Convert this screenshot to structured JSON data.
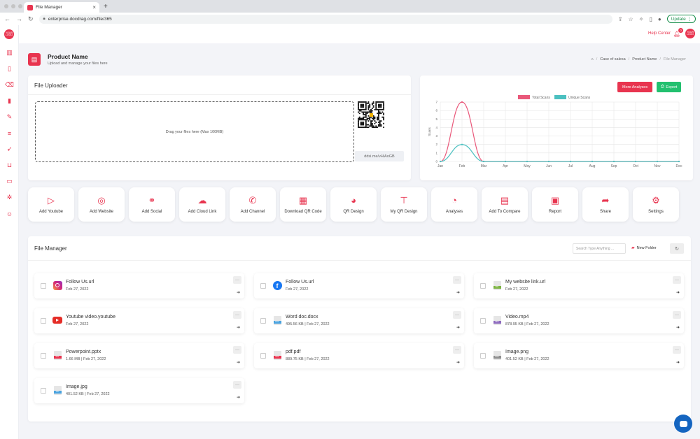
{
  "browser": {
    "tab_title": "File Manager",
    "url": "enterprise.docdrag.com/file/365",
    "update_label": "Update"
  },
  "sidebar": {
    "logo_text": "YOUR LOGO",
    "icons": [
      "bar-chart-icon",
      "document-icon",
      "trash-icon",
      "stats-icon",
      "brush-icon",
      "list-icon",
      "rocket-icon",
      "cart-icon",
      "card-icon",
      "settings-icon",
      "user-icon"
    ]
  },
  "topbar": {
    "help_label": "Help Center",
    "notification_count": "0",
    "avatar_text": "YOUR LOGO"
  },
  "header": {
    "title": "Product Name",
    "subtitle": "Upload and manage your files here",
    "breadcrumb": [
      "Case of salesa",
      "Product Name",
      "File Manager"
    ]
  },
  "uploader": {
    "title": "File Uploader",
    "drop_text": "Drag your files here (Max 100MB)",
    "short_link": "ddsi.me/vHiAoGB"
  },
  "chart_card": {
    "more_label": "More Analyses",
    "export_label": "Export"
  },
  "chart_data": {
    "type": "line",
    "categories": [
      "Jan",
      "Feb",
      "Mar",
      "Apr",
      "May",
      "Jun",
      "Jul",
      "Aug",
      "Sep",
      "Oct",
      "Nov",
      "Dec"
    ],
    "series": [
      {
        "name": "Total Scans",
        "color": "#e9587a",
        "values": [
          0,
          7,
          0,
          0,
          0,
          0,
          0,
          0,
          0,
          0,
          0,
          0
        ]
      },
      {
        "name": "Unique Scans",
        "color": "#4bc0c0",
        "values": [
          0,
          2,
          0,
          0,
          0,
          0,
          0,
          0,
          0,
          0,
          0,
          0
        ]
      }
    ],
    "ylabel": "Scans",
    "ylim": [
      0,
      7
    ],
    "yticks": [
      "0",
      "1",
      "2",
      "3",
      "4",
      "5",
      "6",
      "7"
    ],
    "grid": true,
    "legend": "top"
  },
  "actions": [
    {
      "label": "Add Youtube",
      "icon": "youtube-icon",
      "glyph": "▷"
    },
    {
      "label": "Add Website",
      "icon": "globe-icon",
      "glyph": "◎"
    },
    {
      "label": "Add Social",
      "icon": "link-icon",
      "glyph": "⚭"
    },
    {
      "label": "Add Cloud Link",
      "icon": "cloud-icon",
      "glyph": "☁"
    },
    {
      "label": "Add Channel",
      "icon": "phone-icon",
      "glyph": "✆"
    },
    {
      "label": "Download QR Code",
      "icon": "qr-icon",
      "glyph": "▦"
    },
    {
      "label": "QR Design",
      "icon": "palette-icon",
      "glyph": "◕"
    },
    {
      "label": "My QR Design",
      "icon": "paint-roller-icon",
      "glyph": "⊤"
    },
    {
      "label": "Analyses",
      "icon": "pie-chart-icon",
      "glyph": "◔"
    },
    {
      "label": "Add To Compare",
      "icon": "calculator-icon",
      "glyph": "▤"
    },
    {
      "label": "Report",
      "icon": "report-icon",
      "glyph": "▣"
    },
    {
      "label": "Share",
      "icon": "share-icon",
      "glyph": "➦"
    },
    {
      "label": "Settings",
      "icon": "gear-icon",
      "glyph": "⚙"
    }
  ],
  "file_manager": {
    "title": "File Manager",
    "search_placeholder": "Search Type Anything ...",
    "new_folder_label": "New Folder",
    "files": [
      {
        "name": "Follow Us.url",
        "meta": "Feb 27, 2022",
        "icon": "instagram-icon"
      },
      {
        "name": "Follow Us.url",
        "meta": "Feb 27, 2022",
        "icon": "facebook-icon"
      },
      {
        "name": "My website link.url",
        "meta": "Feb 27, 2022",
        "icon": "url-file-icon"
      },
      {
        "name": "Youtube video.youtube",
        "meta": "Feb 27, 2022",
        "icon": "youtube-icon"
      },
      {
        "name": "Word doc.docx",
        "meta": "495.56 KB | Feb 27, 2022",
        "icon": "docx-file-icon"
      },
      {
        "name": "Video.mp4",
        "meta": "878.95 KB | Feb 27, 2022",
        "icon": "mp4-file-icon"
      },
      {
        "name": "Powerpoint.pptx",
        "meta": "1.66 MB | Feb 27, 2022",
        "icon": "pptx-file-icon"
      },
      {
        "name": "pdf.pdf",
        "meta": "889.75 KB | Feb 27, 2022",
        "icon": "pdf-file-icon"
      },
      {
        "name": "Image.png",
        "meta": "401.52 KB | Feb 27, 2022",
        "icon": "png-file-icon"
      },
      {
        "name": "Image.jpg",
        "meta": "401.52 KB | Feb 27, 2022",
        "icon": "jpg-file-icon"
      }
    ]
  },
  "colors": {
    "accent": "#e8344f",
    "export": "#22c06f",
    "chat": "#1565c0"
  }
}
